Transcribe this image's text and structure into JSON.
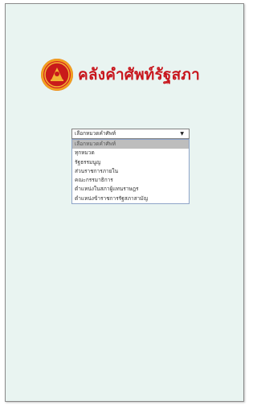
{
  "brand": {
    "title": "คลังคำศัพท์รัฐสภา",
    "logo_icon": "parliament-seal-icon"
  },
  "category_select": {
    "value": "เลือกหมวดคำศัพท์",
    "options": [
      "เลือกหมวดคำศัพท์",
      "ทุกหมวด",
      "รัฐธรรมนูญ",
      "ส่วนราชการภายใน",
      "คณะกรรมาธิการ",
      "ตำแหน่งในสภาผู้แทนราษฎร",
      "ตำแหน่งข้าราชการรัฐสภาสามัญ"
    ],
    "selected_index": 0
  },
  "colors": {
    "background": "#e9f4f1",
    "brand": "#c8161d",
    "highlight": "#bdbdbd"
  }
}
